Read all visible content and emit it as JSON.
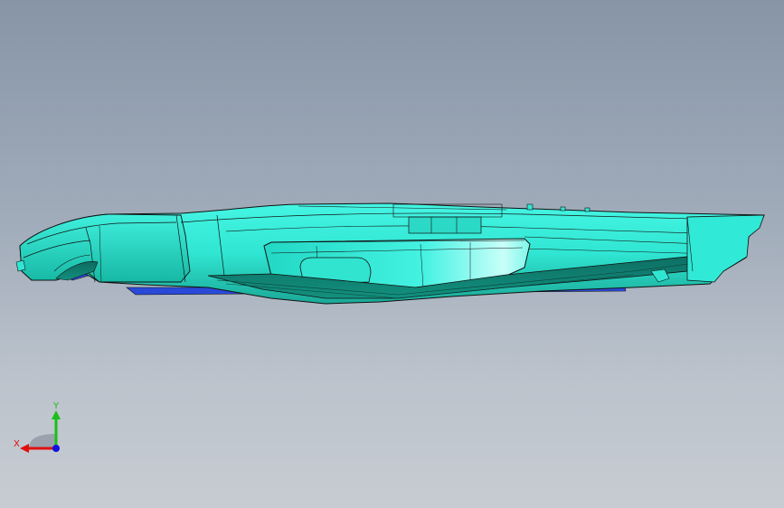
{
  "viewport": {
    "background_top": "#8795a7",
    "background_bottom": "#c7ccd2",
    "model": {
      "name": "surface-model",
      "color": "#35f0dc",
      "edge_color": "#1a1a1a"
    }
  },
  "triad": {
    "x_label": "X",
    "y_label": "Y",
    "x_color": "#e01010",
    "y_color": "#18c018",
    "z_color": "#1010e0"
  }
}
